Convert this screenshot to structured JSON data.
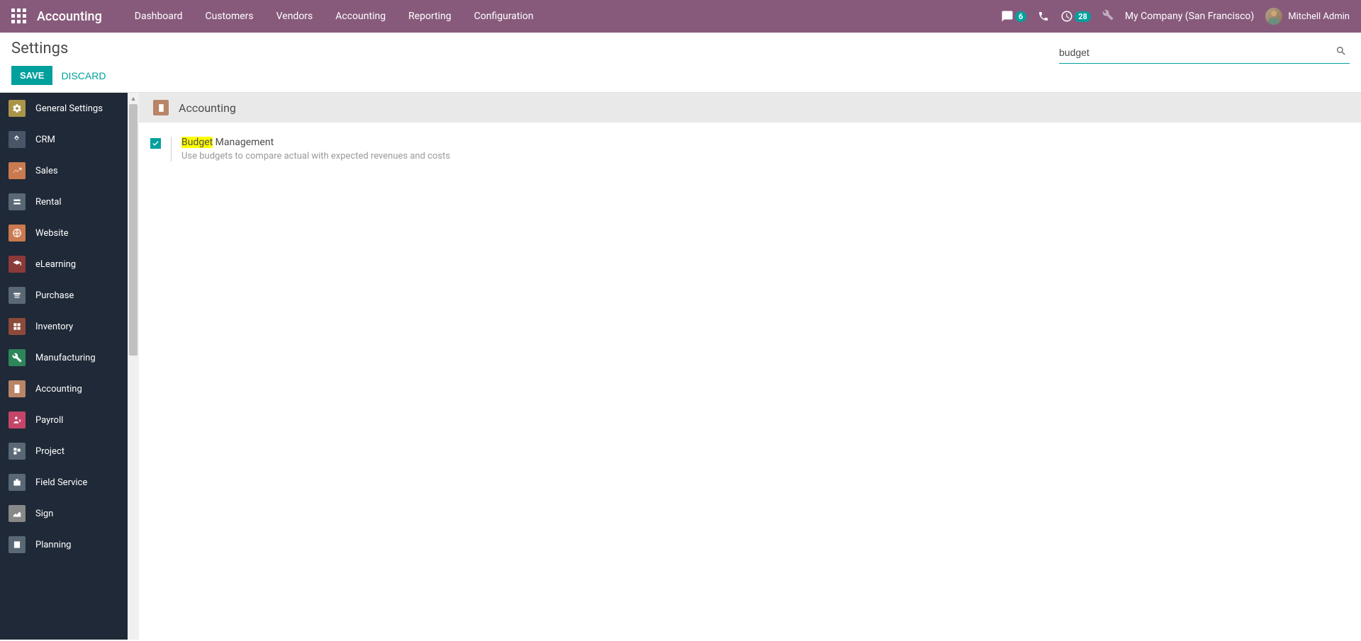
{
  "topbar": {
    "app_name": "Accounting",
    "menu": [
      "Dashboard",
      "Customers",
      "Vendors",
      "Accounting",
      "Reporting",
      "Configuration"
    ],
    "messages_badge": "6",
    "activities_badge": "28",
    "company": "My Company (San Francisco)",
    "user": "Mitchell Admin"
  },
  "controlpanel": {
    "title": "Settings",
    "save": "SAVE",
    "discard": "DISCARD",
    "search_value": "budget"
  },
  "sidebar": {
    "items": [
      {
        "label": "General Settings",
        "color": "#aa9448"
      },
      {
        "label": "CRM",
        "color": "#4a5568"
      },
      {
        "label": "Sales",
        "color": "#c97a50"
      },
      {
        "label": "Rental",
        "color": "#5a6775"
      },
      {
        "label": "Website",
        "color": "#c97a50"
      },
      {
        "label": "eLearning",
        "color": "#8b3a3a"
      },
      {
        "label": "Purchase",
        "color": "#5a6775"
      },
      {
        "label": "Inventory",
        "color": "#8b4a3a"
      },
      {
        "label": "Manufacturing",
        "color": "#2d8659"
      },
      {
        "label": "Accounting",
        "color": "#b88566"
      },
      {
        "label": "Payroll",
        "color": "#c44569"
      },
      {
        "label": "Project",
        "color": "#5a6775"
      },
      {
        "label": "Field Service",
        "color": "#5a6775"
      },
      {
        "label": "Sign",
        "color": "#888888"
      },
      {
        "label": "Planning",
        "color": "#5a6775"
      }
    ]
  },
  "content": {
    "section_title": "Accounting",
    "setting": {
      "checked": true,
      "label_highlight": "Budget",
      "label_rest": " Management",
      "description": "Use budgets to compare actual with expected revenues and costs"
    }
  }
}
